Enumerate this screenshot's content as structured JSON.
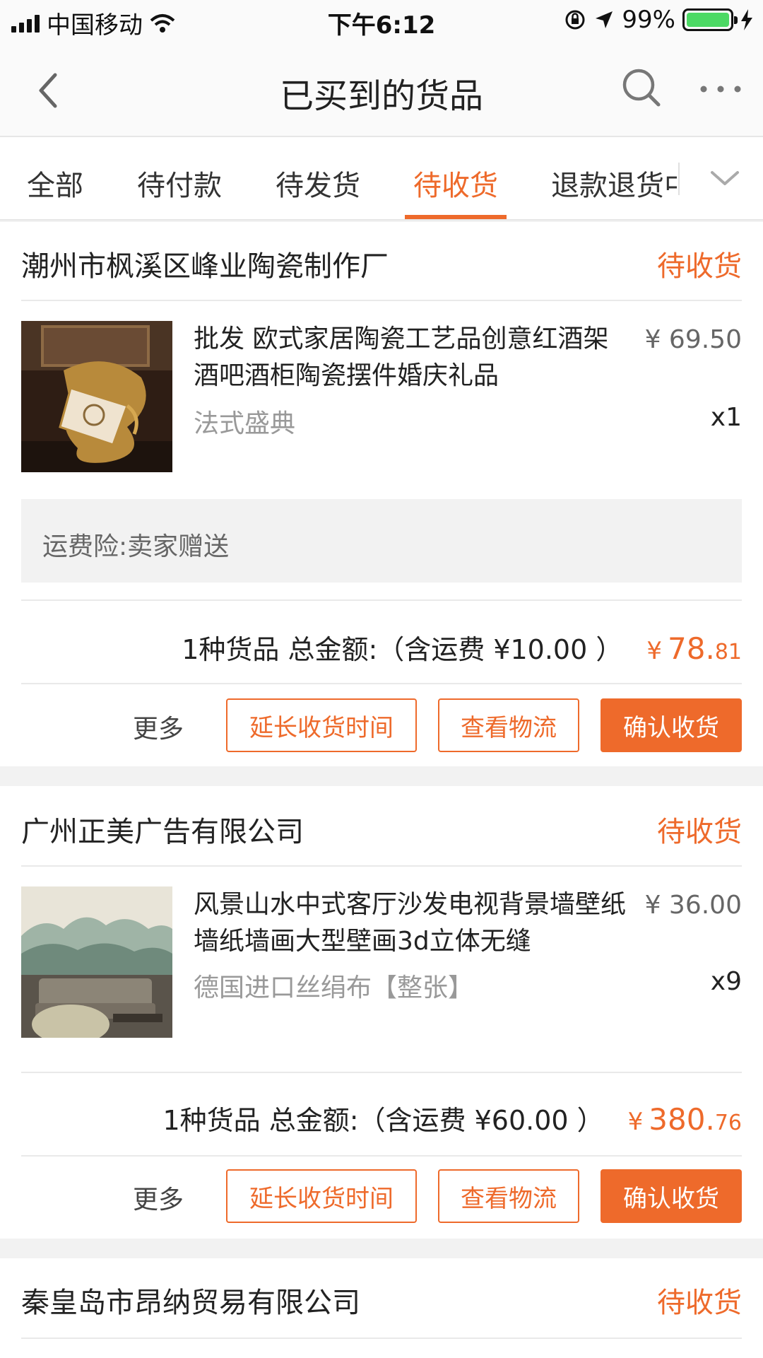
{
  "status_bar": {
    "carrier": "中国移动",
    "time": "下午6:12",
    "battery": "99%",
    "battery_level": 0.99,
    "icons": [
      "signal-icon",
      "wifi-icon",
      "orientation-lock-icon",
      "location-arrow-icon",
      "battery-icon",
      "charging-bolt-icon"
    ]
  },
  "nav": {
    "title": "已买到的货品",
    "icons": [
      "back-chevron-icon",
      "search-icon",
      "more-dots-icon"
    ]
  },
  "tabs": [
    {
      "label": "全部",
      "active": false
    },
    {
      "label": "待付款",
      "active": false
    },
    {
      "label": "待发货",
      "active": false
    },
    {
      "label": "待收货",
      "active": true
    },
    {
      "label": "退款退货中",
      "active": false
    }
  ],
  "colors": {
    "accent": "#ee6a2b",
    "background": "#f2f2f2",
    "text": "#222222",
    "muted": "#999999"
  },
  "orders": [
    {
      "shop": "潮州市枫溪区峰业陶瓷制作厂",
      "status": "待收货",
      "item": {
        "title": "批发 欧式家居陶瓷工艺品创意红酒架 酒吧酒柜陶瓷摆件婚庆礼品",
        "spec": "法式盛典",
        "price": "¥ 69.50",
        "qty": "x1"
      },
      "insurance": "运费险:卖家赠送",
      "summary": {
        "text": "1种货品 总金额:（含运费 ¥10.00 ）",
        "yen": "¥",
        "total_int": "78.",
        "total_dec": "81"
      },
      "actions": {
        "more": "更多",
        "extend": "延长收货时间",
        "logistics": "查看物流",
        "confirm": "确认收货"
      }
    },
    {
      "shop": "广州正美广告有限公司",
      "status": "待收货",
      "item": {
        "title": "风景山水中式客厅沙发电视背景墙壁纸墙纸墙画大型壁画3d立体无缝",
        "spec": "德国进口丝绢布【整张】",
        "price": "¥ 36.00",
        "qty": "x9"
      },
      "summary": {
        "text": "1种货品 总金额:（含运费 ¥60.00 ）",
        "yen": "¥",
        "total_int": "380.",
        "total_dec": "76"
      },
      "actions": {
        "more": "更多",
        "extend": "延长收货时间",
        "logistics": "查看物流",
        "confirm": "确认收货"
      }
    },
    {
      "shop": "秦皇岛市昂纳贸易有限公司",
      "status": "待收货"
    }
  ]
}
